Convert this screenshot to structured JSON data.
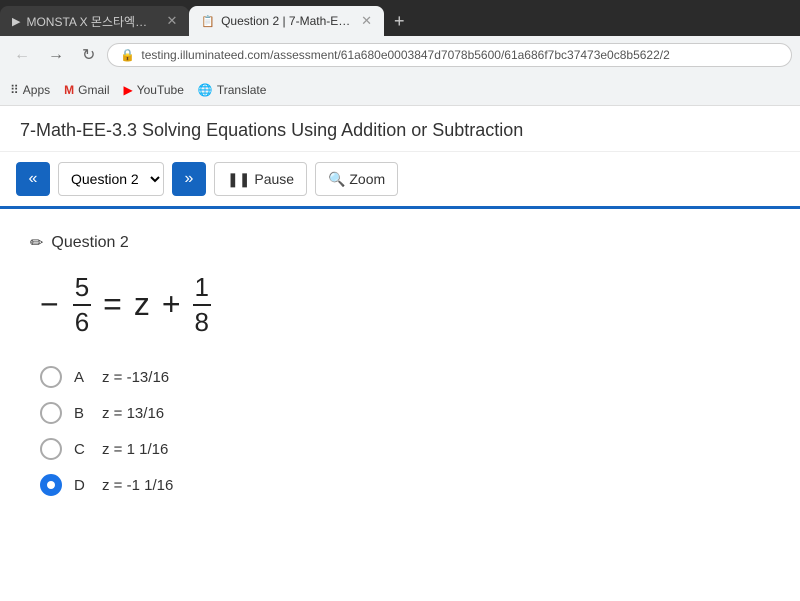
{
  "browser": {
    "tabs": [
      {
        "id": "tab1",
        "label": "MONSTA X 몬스타엑스 'ON",
        "icon": "▶",
        "active": false
      },
      {
        "id": "tab2",
        "label": "Question 2 | 7-Math-EE-3.3 Solvi",
        "icon": "📋",
        "active": true
      }
    ],
    "new_tab_label": "+",
    "nav": {
      "back_label": "←",
      "forward_label": "→",
      "refresh_label": "↻"
    },
    "address": "testing.illuminateed.com/assessment/61a680e0003847d7078b5600/61a686f7bc37473e0c8b5622/2",
    "lock_icon": "🔒",
    "bookmarks": [
      {
        "id": "apps",
        "label": "Apps",
        "icon": "⠿"
      },
      {
        "id": "gmail",
        "label": "Gmail",
        "icon": "M"
      },
      {
        "id": "youtube",
        "label": "YouTube",
        "icon": "▶"
      },
      {
        "id": "translate",
        "label": "Translate",
        "icon": "🌐"
      }
    ]
  },
  "page": {
    "title": "7-Math-EE-3.3 Solving Equations Using Addition or Subtraction",
    "toolbar": {
      "prev_label": "«",
      "question_selector": "Question 2",
      "next_label": "»",
      "pause_label": "❚❚ Pause",
      "zoom_label": "🔍 Zoom"
    },
    "question": {
      "header": "Question 2",
      "equation": {
        "left_num": "5",
        "left_den": "6",
        "right_z": "z",
        "right_num": "1",
        "right_den": "8"
      },
      "options": [
        {
          "id": "A",
          "letter": "A",
          "text": "z = -13/16",
          "selected": false
        },
        {
          "id": "B",
          "letter": "B",
          "text": "z = 13/16",
          "selected": false
        },
        {
          "id": "C",
          "letter": "C",
          "text": "z = 1 1/16",
          "selected": false
        },
        {
          "id": "D",
          "letter": "D",
          "text": "z = -1 1/16",
          "selected": true
        }
      ]
    }
  },
  "colors": {
    "primary": "#1565c0",
    "selected": "#1a73e8",
    "toolbar_border": "#1565c0"
  }
}
